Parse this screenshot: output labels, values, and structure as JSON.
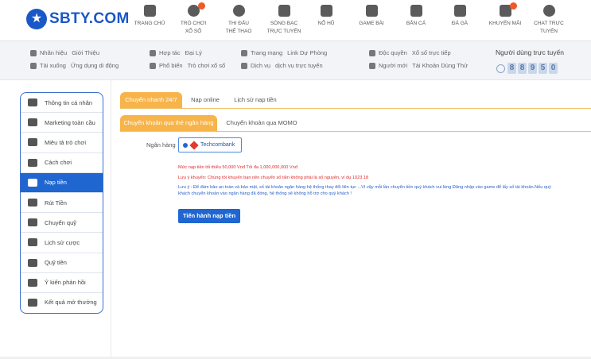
{
  "header": {
    "logo": "SBTY.COM",
    "nav": [
      {
        "label": "TRANG CHỦ",
        "hot": false
      },
      {
        "label": "TRÒ CHƠI\nXỔ SỐ",
        "hot": true
      },
      {
        "label": "THI ĐẤU\nTHỂ THAO",
        "hot": false
      },
      {
        "label": "SÒNG BẠC\nTRỰC TUYẾN",
        "hot": false
      },
      {
        "label": "NỔ HŨ",
        "hot": false
      },
      {
        "label": "GAME BÀI",
        "hot": false
      },
      {
        "label": "BẮN CÁ",
        "hot": false
      },
      {
        "label": "ĐÁ GÀ",
        "hot": false
      },
      {
        "label": "KHUYẾN MÃI",
        "hot": true
      },
      {
        "label": "CHAT TRỰC\nTUYẾN",
        "hot": false
      }
    ]
  },
  "subnav": {
    "row1": [
      "Nhãn hiệu",
      "Giới Thiệu",
      "Hợp tác",
      "Đại Lý",
      "Trang mạng",
      "Link Dự Phòng",
      "Độc quyền",
      "Xổ số trực tiếp"
    ],
    "row2": [
      "Tải xuống",
      "Ứng dụng di động",
      "Phổ biến",
      "Trò chơi xổ số",
      "Dịch vụ",
      "dịch vụ trực tuyến",
      "Người mới",
      "Tài Khoản Dùng Thử"
    ],
    "online_title": "Người dùng trực tuyến",
    "online_digits": [
      "8",
      "8",
      "9",
      "5",
      "0"
    ]
  },
  "sidebar": {
    "items": [
      {
        "label": "Thông tin cá nhân",
        "icon": "id-card-icon"
      },
      {
        "label": "Marketing toàn cầu",
        "icon": "diamond-icon"
      },
      {
        "label": "Miêu tả trò chơi",
        "icon": "gamepad-icon"
      },
      {
        "label": "Cách chơi",
        "icon": "info-icon"
      },
      {
        "label": "Nạp tiền",
        "icon": "piggy-bank-icon",
        "active": true
      },
      {
        "label": "Rút Tiền",
        "icon": "withdraw-icon"
      },
      {
        "label": "Chuyển quỹ",
        "icon": "transfer-icon"
      },
      {
        "label": "Lịch sử cược",
        "icon": "history-icon"
      },
      {
        "label": "Quỹ tiền",
        "icon": "money-icon"
      },
      {
        "label": "Ý kiến phản hồi",
        "icon": "feedback-icon"
      },
      {
        "label": "Kết quả mở thưởng",
        "icon": "clock-icon"
      }
    ]
  },
  "main": {
    "tabs": [
      "Chuyển nhanh 24/7",
      "Nạp online",
      "Lịch sử nạp tiền"
    ],
    "subtabs": [
      "Chuyển khoản qua thẻ ngân hàng",
      "Chuyển khoản qua MOMO"
    ],
    "bank_label": "Ngân hàng",
    "bank_name": "Techcombank",
    "note1": "Mức nạp tiền tối thiểu 50,000 Vnđ Tối đa 1,000,000,000 Vnđ",
    "note2": "Lưu ý khuyến: Chúng tôi khuyến bạn nên chuyển số tiền không phải là số nguyên, ví dụ 1023.18",
    "note3": "Lưu ý : Để đảm bảo an toàn và bảo mật, số tài khoản ngân hàng hệ thống thay đổi liên tục ...Vì vậy mỗi lần chuyển tiền quý khách vui lòng Đăng nhập vào game để lấy số tài khoản.Nếu quý khách chuyển khoản vào ngân hàng đã đóng, hệ thống sẽ không hỗ trợ cho quý khách !",
    "submit": "Tiến hành nạp tiền"
  },
  "colors": {
    "brand": "#1a57c7",
    "tab": "#f7b44a",
    "active": "#1f66d1",
    "warn": "#e02a2a"
  }
}
